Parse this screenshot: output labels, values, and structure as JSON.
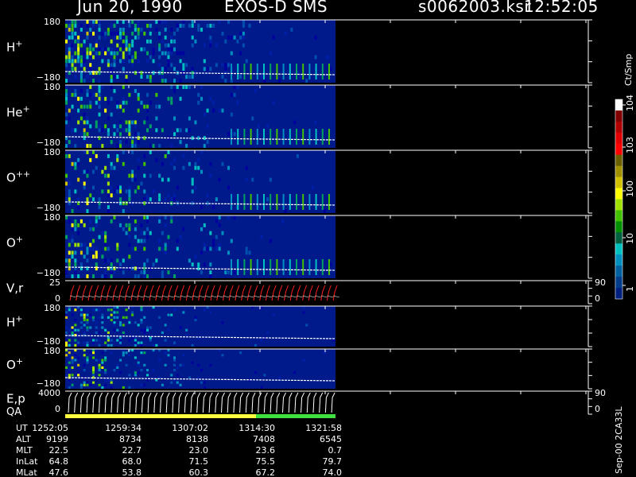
{
  "header": {
    "date": "Jun 20, 1990",
    "instrument": "EXOS-D SMS",
    "file": "s0062003.ksr",
    "time": "12:52:05"
  },
  "colorbar": {
    "unit": "Ct/Smp",
    "ticks": [
      "10^4",
      "10^3",
      "100",
      "10",
      "1"
    ],
    "colors": [
      "#ffffff",
      "#800000",
      "#b00000",
      "#e00000",
      "#ff0000",
      "#6b6000",
      "#a09000",
      "#d0c000",
      "#ffff00",
      "#a0e000",
      "#40c000",
      "#009000",
      "#006040",
      "#00c0c0",
      "#0090c0",
      "#0060a0",
      "#003c8a",
      "#002080"
    ]
  },
  "panels": [
    {
      "id": "h",
      "label": "H",
      "sup": "+",
      "ytop": "180",
      "ybot": "−180",
      "kind": "spec",
      "density": 0.55
    },
    {
      "id": "he",
      "label": "He",
      "sup": "+",
      "ytop": "180",
      "ybot": "−180",
      "kind": "spec",
      "density": 0.35
    },
    {
      "id": "opp",
      "label": "O",
      "sup": "++",
      "ytop": "180",
      "ybot": "−180",
      "kind": "spec",
      "density": 0.25
    },
    {
      "id": "op",
      "label": "O",
      "sup": "+",
      "ytop": "180",
      "ybot": "−180",
      "kind": "spec",
      "density": 0.35
    },
    {
      "id": "vr",
      "label": "V,r",
      "sup": "",
      "ytop": "25",
      "ybot": "0",
      "right_top": "90",
      "right_bot": "0",
      "kind": "vr"
    },
    {
      "id": "h2",
      "label": "H",
      "sup": "+",
      "ytop": "180",
      "ybot": "−180",
      "kind": "spec2",
      "density": 0.4
    },
    {
      "id": "o2",
      "label": "O",
      "sup": "+",
      "ytop": "180",
      "ybot": "−180",
      "kind": "spec2",
      "density": 0.3
    },
    {
      "id": "ep",
      "label": "E,p",
      "sup": "",
      "ytop": "4000",
      "ybot": "0",
      "right_top": "90",
      "right_bot": "0",
      "kind": "ep"
    }
  ],
  "qa_label": "QA",
  "ephemeris": {
    "labels": [
      "UT",
      "ALT",
      "MLT",
      "InLat",
      "MLat"
    ],
    "columns": [
      {
        "UT": "1252:05",
        "ALT": "9199",
        "MLT": "22.5",
        "InLat": "64.8",
        "MLat": "47.6"
      },
      {
        "UT": "1259:34",
        "ALT": "8734",
        "MLT": "22.7",
        "InLat": "68.0",
        "MLat": "53.8"
      },
      {
        "UT": "1307:02",
        "ALT": "8138",
        "MLT": "23.0",
        "InLat": "71.5",
        "MLat": "60.3"
      },
      {
        "UT": "1314:30",
        "ALT": "7408",
        "MLT": "23.6",
        "InLat": "75.5",
        "MLat": "67.2"
      },
      {
        "UT": "1321:58",
        "ALT": "6545",
        "MLT": "0.7",
        "InLat": "79.7",
        "MLat": "74.0"
      }
    ]
  },
  "footer": "Sep-00 2CA33L",
  "chart_data": {
    "type": "heatmap",
    "title": "Jun 20, 1990   EXOS-D SMS",
    "x_ticks_ut": [
      "1252:05",
      "1259:34",
      "1307:02",
      "1314:30",
      "1321:58"
    ],
    "panel_ylims": {
      "ion_spectrograms": [
        -180,
        180
      ],
      "V,r": [
        0,
        25
      ],
      "E,p": [
        0,
        4000
      ],
      "right_axis": [
        0,
        90
      ]
    },
    "colorscale": {
      "unit": "Ct/Smp",
      "range": [
        1,
        10000
      ],
      "log": true
    },
    "data_coverage_fraction": 0.51
  }
}
